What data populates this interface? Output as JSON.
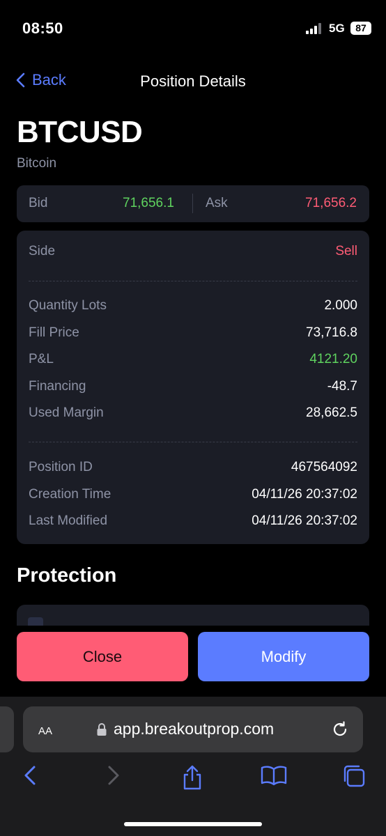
{
  "status_bar": {
    "time": "08:50",
    "network": "5G",
    "battery": "87"
  },
  "nav": {
    "back_label": "Back",
    "title": "Position Details"
  },
  "instrument": {
    "symbol": "BTCUSD",
    "name": "Bitcoin"
  },
  "quote": {
    "bid_label": "Bid",
    "bid_value": "71,656.1",
    "ask_label": "Ask",
    "ask_value": "71,656.2"
  },
  "details": {
    "side": {
      "label": "Side",
      "value": "Sell"
    },
    "quantity": {
      "label": "Quantity Lots",
      "value": "2.000"
    },
    "fill_price": {
      "label": "Fill Price",
      "value": "73,716.8"
    },
    "pnl": {
      "label": "P&L",
      "value": "4121.20"
    },
    "financing": {
      "label": "Financing",
      "value": "-48.7"
    },
    "used_margin": {
      "label": "Used Margin",
      "value": "28,662.5"
    },
    "position_id": {
      "label": "Position ID",
      "value": "467564092"
    },
    "creation_time": {
      "label": "Creation Time",
      "value": "04/11/26 20:37:02"
    },
    "last_modified": {
      "label": "Last Modified",
      "value": "04/11/26 20:37:02"
    }
  },
  "protection": {
    "title": "Protection"
  },
  "actions": {
    "close_label": "Close",
    "modify_label": "Modify"
  },
  "browser": {
    "aa_label": "AA",
    "url": "app.breakoutprop.com"
  },
  "colors": {
    "accent": "#5b7cff",
    "profit": "#5fd35f",
    "sell": "#ff5c75",
    "card": "#1b1d26"
  }
}
